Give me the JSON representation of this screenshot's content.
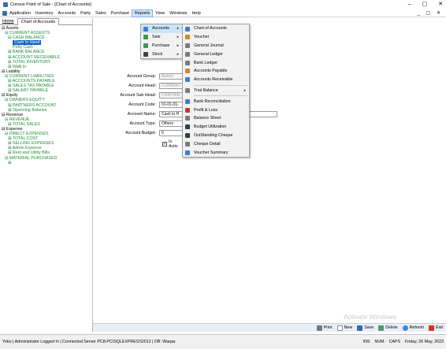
{
  "window": {
    "title": "Consus Point of Sale     - [Chart of Accounts]",
    "minimize": "–",
    "maximize": "▢",
    "close": "✕"
  },
  "menubar": {
    "items": [
      "Application",
      "Inventory",
      "Accounts",
      "Party",
      "Sales",
      "Purchase",
      "Reports",
      "View",
      "Windows",
      "Help"
    ],
    "mdi_controls": "_ ▢ ✕"
  },
  "left_tabs": {
    "home": "Home",
    "active": "Chart of Accounts"
  },
  "tree": [
    {
      "label": "⊟ Assets",
      "level": 0
    },
    {
      "label": "⊟ CURRENT ASSESTS",
      "level": 1
    },
    {
      "label": "⊟ CASH BALANCE",
      "level": 2
    },
    {
      "label": "Cash In Hand",
      "level": 3,
      "selected": true
    },
    {
      "label": "Petty Cash",
      "level": 3
    },
    {
      "label": "⊞ BANK BALANCE",
      "level": 2
    },
    {
      "label": "⊞ ACCOUNT RECEIVABLE",
      "level": 2
    },
    {
      "label": "⊞ TOTAL INVENTORY",
      "level": 2
    },
    {
      "label": "⊞ Walk In",
      "level": 2
    },
    {
      "label": "⊟ Liability",
      "level": 0
    },
    {
      "label": "⊟ CURRENT LIABILITIES",
      "level": 1
    },
    {
      "label": "⊞ ACCOUNTS PAYABLE",
      "level": 2
    },
    {
      "label": "⊞ SALES TAX PAYABLE",
      "level": 2
    },
    {
      "label": "⊞ SALARY PAYABLE",
      "level": 2
    },
    {
      "label": "⊟ Equity",
      "level": 0
    },
    {
      "label": "⊟ OWNERS EQUITY",
      "level": 1
    },
    {
      "label": "⊞ PARTNERS ACCOUNT",
      "level": 2
    },
    {
      "label": "⊞ Openning Balance",
      "level": 2
    },
    {
      "label": "⊟ Revenue",
      "level": 0
    },
    {
      "label": "⊟ REVENUE",
      "level": 1
    },
    {
      "label": "⊞ TOTAL SALES",
      "level": 2
    },
    {
      "label": "⊟ Expense",
      "level": 0
    },
    {
      "label": "⊟ DIRECT EXPENSES",
      "level": 1
    },
    {
      "label": "⊞ TOTAL COST",
      "level": 2
    },
    {
      "label": "⊞ SELLING EXPENSES",
      "level": 2
    },
    {
      "label": "⊞ Admin Expense",
      "level": 2
    },
    {
      "label": "⊞ Rent and Utility Bills",
      "level": 2
    },
    {
      "label": "⊟ MATERIAL PURCHASED",
      "level": 1
    },
    {
      "label": "⊞",
      "level": 2
    }
  ],
  "form": {
    "account_group_label": "Account Group:",
    "account_group_value": "Assets",
    "account_head_label": "Account Head:",
    "account_head_value": "CURRENT",
    "account_subhead_label": "Account Sub Head:",
    "account_subhead_value": "CASH BAL",
    "account_code_label": "Account Code:",
    "account_code_value": "01-01-01-",
    "account_name_label": "Account Name:",
    "account_name_value": "Cash In H",
    "account_type_label": "Account Type:",
    "account_type_value": "Others",
    "account_budget_label": "Account Budget:",
    "account_budget_value": "0",
    "is_active_label": "Is Activ",
    "is_active_checked": "✓"
  },
  "reports_menu": {
    "items": [
      {
        "label": "Accounts",
        "has_submenu": true,
        "icon_color": "#3b7dd8"
      },
      {
        "label": "Sale",
        "has_submenu": true,
        "icon_color": "#3a9a4a"
      },
      {
        "label": "Purchase",
        "has_submenu": true,
        "icon_color": "#3a9a4a"
      },
      {
        "label": "Stock",
        "has_submenu": true,
        "icon_color": "#444444"
      }
    ],
    "arrow": "▸"
  },
  "accounts_submenu": {
    "items": [
      {
        "label": "Chart of Accounts",
        "icon_color": "#3b7dd8"
      },
      {
        "label": "Voucher",
        "icon_color": "#d08a1c"
      },
      {
        "label": "General Journal",
        "icon_color": "#7a7a7a"
      },
      {
        "label": "General Ledger",
        "icon_color": "#7a7a7a"
      },
      {
        "label": "Bank Ledger",
        "icon_color": "#7a7a7a"
      },
      {
        "label": "Accounts Payable",
        "icon_color": "#c98a2a"
      },
      {
        "label": "Accounts Receivable",
        "icon_color": "#3b7dd8"
      },
      {
        "label": "Trial Balance",
        "icon_color": "#7a7a7a",
        "has_submenu": true
      },
      {
        "label": "Bank Reconciliation",
        "icon_color": "#3b7dd8"
      },
      {
        "label": "Profit & Loss",
        "icon_color": "#c0392b"
      },
      {
        "label": "Balance Sheet",
        "icon_color": "#7a7a7a"
      },
      {
        "label": "Budget Utilization",
        "icon_color": "#2c3e50"
      },
      {
        "label": "OutStanding Cheque",
        "icon_color": "#2c3e50"
      },
      {
        "label": "Cheque Detail",
        "icon_color": "#7a7a7a"
      },
      {
        "label": "Voucher Summary",
        "icon_color": "#3b7dd8"
      }
    ],
    "arrow": "▸"
  },
  "toolbar": {
    "print": "Print",
    "new": "New",
    "save": "Save",
    "delete": "Delete",
    "refresh": "Refresh",
    "exit": "Exit"
  },
  "statusbar": {
    "left": "Yoko  |  Administrator Logged In  |  Connected Server PC8-PC\\SQLEXPRESS2012  |  DB: Waqas",
    "ins": "INS",
    "num": "NUM",
    "caps": "CAPS",
    "date": "Friday, 26 May, 2023"
  },
  "watermark": "Activate Windows"
}
